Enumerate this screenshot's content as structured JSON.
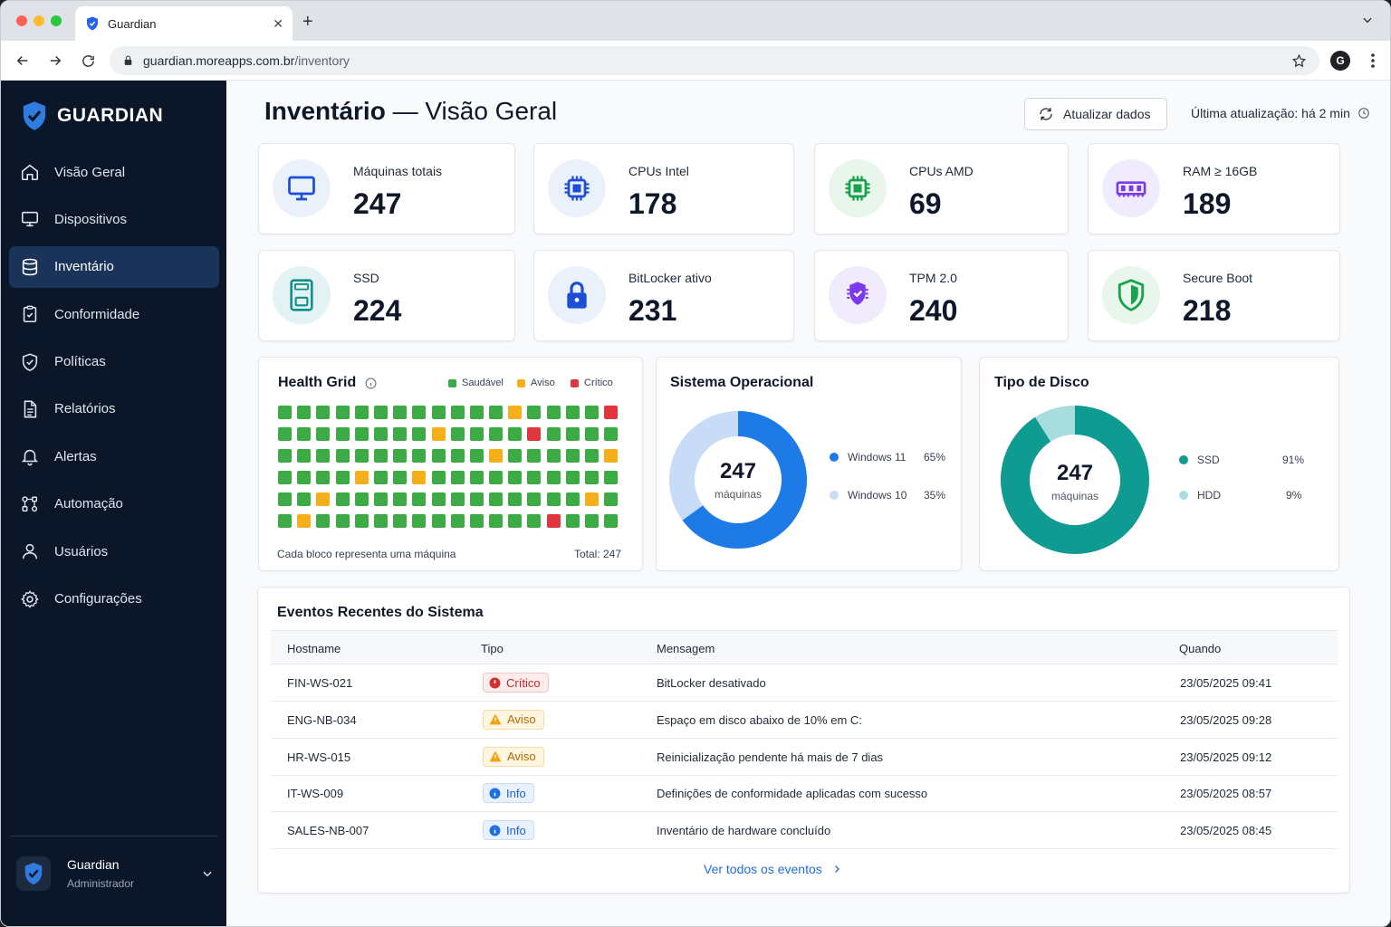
{
  "browser": {
    "tab_title": "Guardian",
    "url_host": "guardian.moreapps.com.br",
    "url_path": "/inventory",
    "profile_initial": "G"
  },
  "sidebar": {
    "brand": "GUARDIAN",
    "items": [
      {
        "label": "Visão Geral",
        "icon": "home-icon"
      },
      {
        "label": "Dispositivos",
        "icon": "monitor-icon"
      },
      {
        "label": "Inventário",
        "icon": "database-icon",
        "active": true
      },
      {
        "label": "Conformidade",
        "icon": "clipboard-check-icon"
      },
      {
        "label": "Políticas",
        "icon": "shield-check-icon"
      },
      {
        "label": "Relatórios",
        "icon": "file-text-icon"
      },
      {
        "label": "Alertas",
        "icon": "bell-icon"
      },
      {
        "label": "Automação",
        "icon": "workflow-icon"
      },
      {
        "label": "Usuários",
        "icon": "user-icon"
      },
      {
        "label": "Configurações",
        "icon": "gear-icon"
      }
    ],
    "user": {
      "name": "Guardian",
      "role": "Administrador"
    }
  },
  "header": {
    "title_bold": "Inventário",
    "title_rest": " — Visão Geral",
    "refresh_label": "Atualizar dados",
    "last_update": "Última atualização: há 2 min"
  },
  "stats": [
    {
      "label": "Máquinas totais",
      "value": "247",
      "icon": "monitor-icon",
      "color": "#1d4ed8",
      "bg": "#eaf1fb"
    },
    {
      "label": "CPUs Intel",
      "value": "178",
      "icon": "cpu-icon",
      "color": "#1d4ed8",
      "bg": "#eaf1fb"
    },
    {
      "label": "CPUs AMD",
      "value": "69",
      "icon": "cpu-icon",
      "color": "#16a34a",
      "bg": "#e8f6ec"
    },
    {
      "label": "RAM ≥ 16GB",
      "value": "189",
      "icon": "memory-icon",
      "color": "#7c3aed",
      "bg": "#f1ecfd"
    },
    {
      "label": "SSD",
      "value": "224",
      "icon": "ssd-icon",
      "color": "#0f8f8a",
      "bg": "#e3f3f3"
    },
    {
      "label": "BitLocker ativo",
      "value": "231",
      "icon": "lock-icon",
      "color": "#1d4ed8",
      "bg": "#eaf1fb"
    },
    {
      "label": "TPM 2.0",
      "value": "240",
      "icon": "tpm-shield-icon",
      "color": "#7c3aed",
      "bg": "#f1ecfd"
    },
    {
      "label": "Secure Boot",
      "value": "218",
      "icon": "shield-icon",
      "color": "#16a34a",
      "bg": "#e8f6ec"
    }
  ],
  "health_grid": {
    "title": "Health Grid",
    "legend": [
      {
        "label": "Saudável",
        "color": "#3dab45"
      },
      {
        "label": "Aviso",
        "color": "#f5b019"
      },
      {
        "label": "Crítico",
        "color": "#e0373f"
      }
    ],
    "rows": [
      "hhhhhhhhhhhhwhhhhc",
      "hhhhhhhhwhhhhchhhh",
      "hhhhhhhhhhhwhhhhhw",
      "hhhhwhhwhhhhhhhhhh",
      "hhwhhhhhhhhhhhhhwh",
      "hwhhhhhhhhhhhhchhh"
    ],
    "caption": "Cada bloco representa uma máquina",
    "total": "Total: 247"
  },
  "os_chart": {
    "title": "Sistema Operacional",
    "center_value": "247",
    "center_label": "máquinas",
    "slices": [
      {
        "label": "Windows 11",
        "percent": 65,
        "pct_label": "65%",
        "color": "#1e7be6"
      },
      {
        "label": "Windows 10",
        "percent": 35,
        "pct_label": "35%",
        "color": "#c9dcf7"
      }
    ]
  },
  "disk_chart": {
    "title": "Tipo de Disco",
    "center_value": "247",
    "center_label": "máquinas",
    "slices": [
      {
        "label": "SSD",
        "percent": 91,
        "pct_label": "91%",
        "color": "#0f9a92"
      },
      {
        "label": "HDD",
        "percent": 9,
        "pct_label": "9%",
        "color": "#a8dde0"
      }
    ]
  },
  "events": {
    "title": "Eventos Recentes do Sistema",
    "columns": [
      "Hostname",
      "Tipo",
      "Mensagem",
      "Quando"
    ],
    "rows": [
      {
        "host": "FIN-WS-021",
        "type": "Crítico",
        "kind": "crit",
        "message": "BitLocker desativado",
        "when": "23/05/2025 09:41"
      },
      {
        "host": "ENG-NB-034",
        "type": "Aviso",
        "kind": "warn",
        "message": "Espaço em disco abaixo de 10% em C:",
        "when": "23/05/2025 09:28"
      },
      {
        "host": "HR-WS-015",
        "type": "Aviso",
        "kind": "warn",
        "message": "Reinicialização pendente há mais de 7 dias",
        "when": "23/05/2025 09:12"
      },
      {
        "host": "IT-WS-009",
        "type": "Info",
        "kind": "info",
        "message": "Definições de conformidade aplicadas com sucesso",
        "when": "23/05/2025 08:57"
      },
      {
        "host": "SALES-NB-007",
        "type": "Info",
        "kind": "info",
        "message": "Inventário de hardware concluído",
        "when": "23/05/2025 08:45"
      }
    ],
    "see_all": "Ver todos os eventos"
  }
}
